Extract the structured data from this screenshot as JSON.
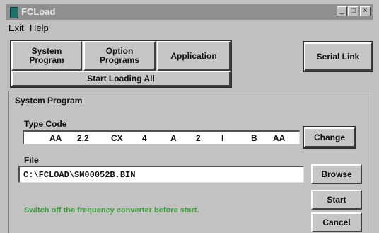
{
  "window": {
    "title": "FCLoad"
  },
  "menu": [
    "Exit",
    "Help"
  ],
  "tabs": {
    "system_program_line1": "System",
    "system_program_line2": "Program",
    "option_programs_line1": "Option",
    "option_programs_line2": "Programs",
    "application": "Application",
    "start_loading_all": "Start Loading All"
  },
  "serial_link": "Serial Link",
  "group": {
    "title": "System Program"
  },
  "type_code": {
    "label": "Type Code",
    "values": [
      "AA",
      "2,2",
      "CX",
      "4",
      "A",
      "2",
      "I",
      "B",
      "AA"
    ],
    "change_button": "Change"
  },
  "file": {
    "label": "File",
    "value": "C:\\FCLOAD\\SM00052B.BIN",
    "browse_button": "Browse"
  },
  "start_button": "Start",
  "cancel_button": "Cancel",
  "hint": "Switch off the frequency converter before start."
}
